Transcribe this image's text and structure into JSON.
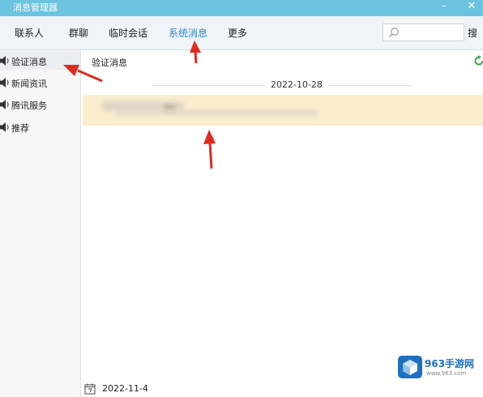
{
  "window": {
    "title": "消息管理器",
    "minimize": "–",
    "close": "✕"
  },
  "tabs": [
    {
      "label": "联系人",
      "active": false
    },
    {
      "label": "群聊",
      "active": false
    },
    {
      "label": "临时会话",
      "active": false
    },
    {
      "label": "系统消息",
      "active": true
    },
    {
      "label": "更多",
      "active": false
    }
  ],
  "search": {
    "placeholder": "",
    "value": "",
    "button": "搜"
  },
  "sidebar": {
    "items": [
      {
        "label": "验证消息",
        "icon": "speaker-icon",
        "active": true
      },
      {
        "label": "新闻资讯",
        "icon": "speaker-icon",
        "active": false
      },
      {
        "label": "腾讯服务",
        "icon": "speaker-icon",
        "active": false
      },
      {
        "label": "推荐",
        "icon": "speaker-icon",
        "active": false
      }
    ]
  },
  "main": {
    "section_title": "验证消息",
    "date_header": "2022-10-28",
    "footer_date": "2022-11-4"
  },
  "watermark": {
    "name": "963手游网",
    "url": "www.963.com"
  },
  "colors": {
    "titlebar": "#6cc3e0",
    "active_tab": "#2e86c9",
    "highlight_row": "#fbeecf",
    "arrow": "#e02a1f"
  }
}
